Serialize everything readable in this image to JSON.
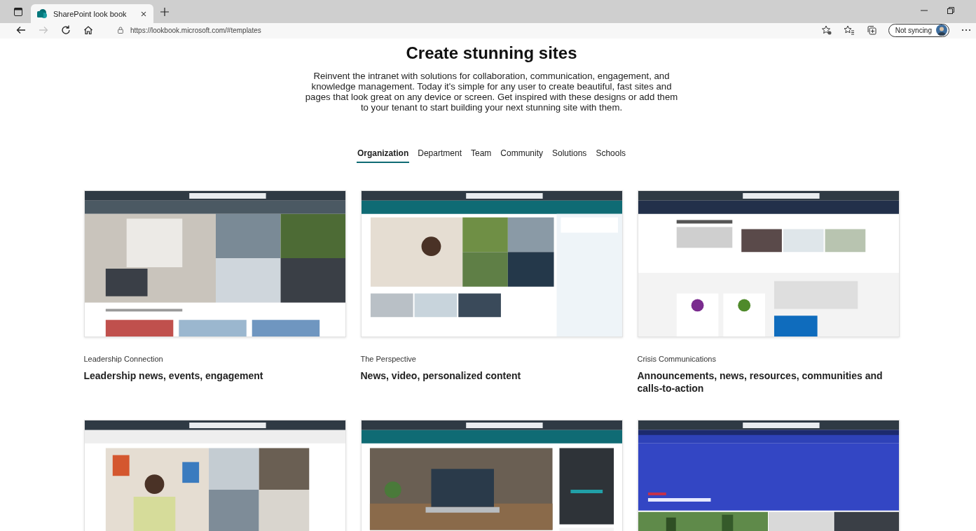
{
  "browser": {
    "tab_title": "SharePoint look book",
    "url": "https://lookbook.microsoft.com/#templates",
    "forward_disabled": true,
    "sync_label": "Not syncing"
  },
  "hero": {
    "title": "Create stunning sites",
    "description": "Reinvent the intranet with solutions for collaboration, communication, engagement, and knowledge management. Today it's simple for any user to create beautiful, fast sites and pages that look great on any device or screen. Get inspired with these designs or add them to your tenant to start building your next stunning site with them."
  },
  "tabs": [
    {
      "label": "Organization",
      "selected": true
    },
    {
      "label": "Department",
      "selected": false
    },
    {
      "label": "Team",
      "selected": false
    },
    {
      "label": "Community",
      "selected": false
    },
    {
      "label": "Solutions",
      "selected": false
    },
    {
      "label": "Schools",
      "selected": false
    }
  ],
  "templates": [
    {
      "category": "Leadership Connection",
      "title": "Leadership news, events, engagement",
      "preview": {
        "kind": "picture"
      }
    },
    {
      "category": "The Perspective",
      "title": "News, video, personalized content",
      "preview": {
        "kind": "picture"
      }
    },
    {
      "category": "Crisis Communications",
      "title": "Announcements, news, resources, communities and calls-to-action",
      "preview": {
        "kind": "picture"
      }
    },
    {
      "preview": {
        "kind": "picture"
      }
    },
    {
      "preview": {
        "kind": "picture"
      }
    },
    {
      "preview": {
        "kind": "picture"
      }
    }
  ]
}
